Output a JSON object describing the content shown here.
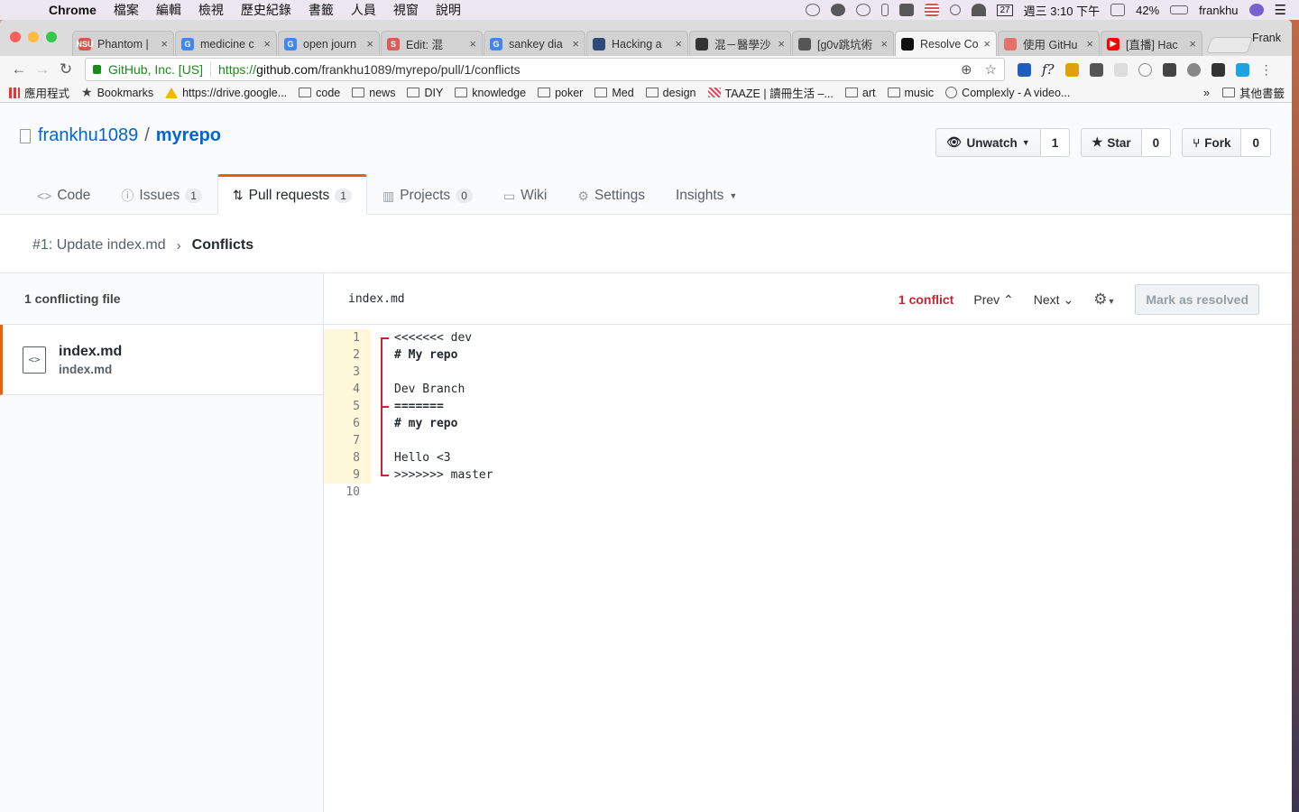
{
  "menubar": {
    "app": "Chrome",
    "items": [
      "檔案",
      "編輯",
      "檢視",
      "歷史紀錄",
      "書籤",
      "人員",
      "視窗",
      "說明"
    ],
    "calendar_day": "27",
    "clock": "週三 3:10 下午",
    "battery": "42%",
    "user": "frankhu"
  },
  "browser": {
    "tabs": [
      {
        "title": "Phantom |",
        "fav": "NSU",
        "color": "#d9534f"
      },
      {
        "title": "medicine c",
        "fav": "G",
        "color": "#4285f4"
      },
      {
        "title": "open journ",
        "fav": "G",
        "color": "#4285f4"
      },
      {
        "title": "Edit: 混",
        "fav": "S",
        "color": "#e05a5a"
      },
      {
        "title": "sankey dia",
        "fav": "G",
        "color": "#4285f4"
      },
      {
        "title": "Hacking a",
        "fav": "",
        "color": "#2d4a7a"
      },
      {
        "title": "混－醫學沙",
        "fav": "",
        "color": "#333333"
      },
      {
        "title": "[g0v跳坑術",
        "fav": "",
        "color": "#555555"
      },
      {
        "title": "Resolve Co",
        "fav": "",
        "color": "#111111"
      },
      {
        "title": "使用 GitHu",
        "fav": "",
        "color": "#e8706a"
      },
      {
        "title": "[直播] Hac",
        "fav": "▶",
        "color": "#ff0000"
      }
    ],
    "profile": "Frank",
    "secure_label": "GitHub, Inc. [US]",
    "url_prefix": "https://",
    "url_host": "github.com",
    "url_path": "/frankhu1089/myrepo/pull/1/conflicts",
    "bookmarks": [
      {
        "label": "應用程式",
        "icon": "apps"
      },
      {
        "label": "Bookmarks",
        "icon": "star"
      },
      {
        "label": "https://drive.google...",
        "icon": "drive"
      },
      {
        "label": "code",
        "icon": "folder"
      },
      {
        "label": "news",
        "icon": "folder"
      },
      {
        "label": "DIY",
        "icon": "folder"
      },
      {
        "label": "knowledge",
        "icon": "folder"
      },
      {
        "label": "poker",
        "icon": "folder"
      },
      {
        "label": "Med",
        "icon": "folder"
      },
      {
        "label": "design",
        "icon": "folder"
      },
      {
        "label": "TAAZE | 讀冊生活 –...",
        "icon": "taaze"
      },
      {
        "label": "art",
        "icon": "folder"
      },
      {
        "label": "music",
        "icon": "folder"
      },
      {
        "label": "Complexly - A video...",
        "icon": "cx"
      }
    ],
    "more_bookmarks": "»",
    "other_bookmarks": "其他書籤"
  },
  "repo": {
    "owner": "frankhu1089",
    "slash": "/",
    "name": "myrepo",
    "watch_label": "Unwatch",
    "watch_count": "1",
    "star_label": "Star",
    "star_count": "0",
    "fork_label": "Fork",
    "fork_count": "0"
  },
  "nav": {
    "code": "Code",
    "issues": "Issues",
    "issues_count": "1",
    "pulls": "Pull requests",
    "pulls_count": "1",
    "projects": "Projects",
    "projects_count": "0",
    "wiki": "Wiki",
    "settings": "Settings",
    "insights": "Insights"
  },
  "breadcrumb": {
    "pr": "#1: Update index.md",
    "current": "Conflicts"
  },
  "sidebar": {
    "heading": "1 conflicting file",
    "file_name": "index.md",
    "file_path": "index.md"
  },
  "editor": {
    "file": "index.md",
    "conflict_count": "1 conflict",
    "prev": "Prev",
    "next": "Next",
    "mark_resolved": "Mark as resolved",
    "lines": [
      {
        "n": "1",
        "text": "<<<<<<< dev",
        "bold": false
      },
      {
        "n": "2",
        "text": "# My repo",
        "bold": true
      },
      {
        "n": "3",
        "text": "",
        "bold": false
      },
      {
        "n": "4",
        "text": "Dev Branch",
        "bold": false
      },
      {
        "n": "5",
        "text": "=======",
        "bold": true
      },
      {
        "n": "6",
        "text": "# my repo",
        "bold": true
      },
      {
        "n": "7",
        "text": "",
        "bold": false
      },
      {
        "n": "8",
        "text": "Hello <3",
        "bold": false
      },
      {
        "n": "9",
        "text": ">>>>>>> master",
        "bold": false
      },
      {
        "n": "10",
        "text": "",
        "bold": false
      }
    ]
  }
}
